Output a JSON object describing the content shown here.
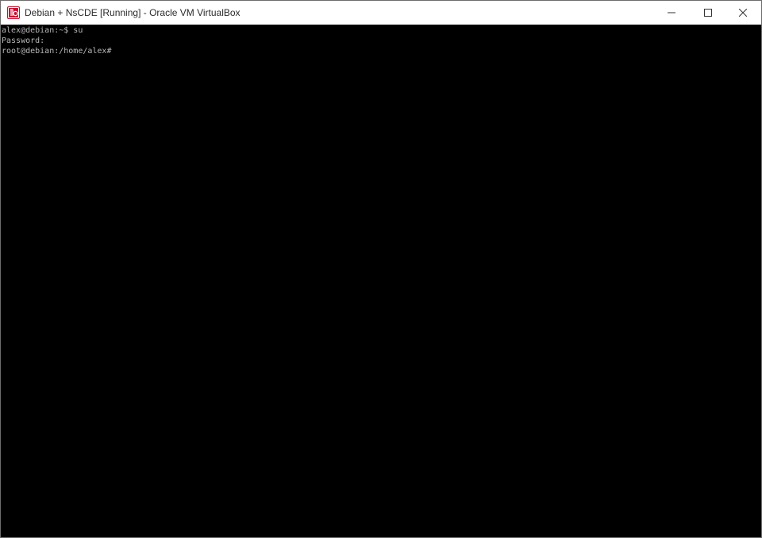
{
  "window": {
    "title": "Debian + NsCDE [Running] - Oracle VM VirtualBox",
    "app_icon": "virtualbox-icon",
    "controls": {
      "minimize": "minimize-icon",
      "maximize": "maximize-icon",
      "close": "close-icon"
    }
  },
  "terminal": {
    "lines": [
      "alex@debian:~$ su",
      "Password:",
      "root@debian:/home/alex#"
    ],
    "background": "#000000",
    "foreground": "#b9b9b9"
  },
  "colors": {
    "icon_red": "#c8102e",
    "titlebar": "#ffffff"
  }
}
